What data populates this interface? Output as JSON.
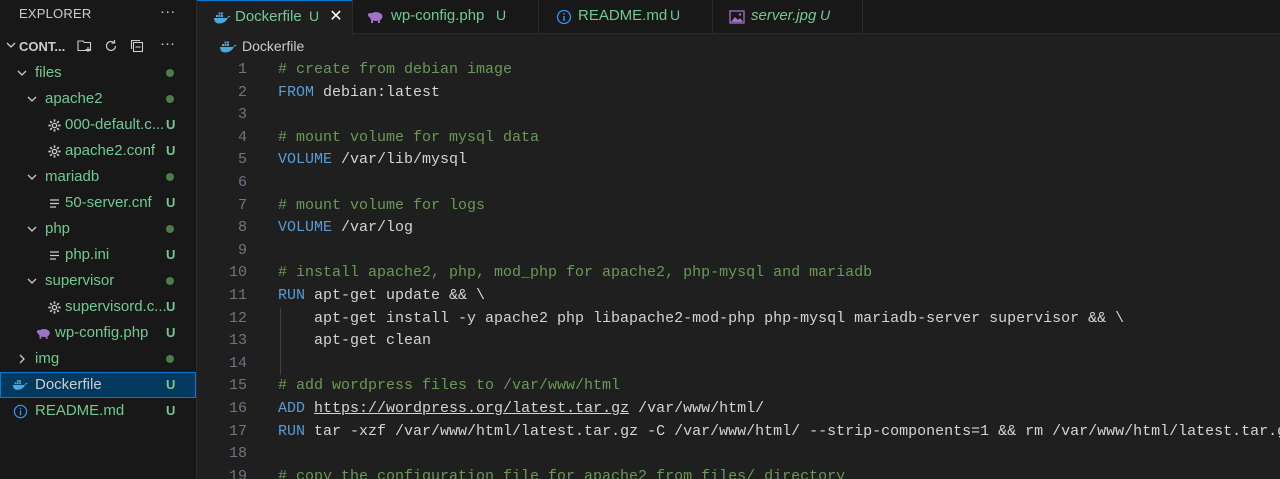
{
  "explorer": {
    "title": "EXPLORER",
    "section_title": "CONT...",
    "tree": [
      {
        "label": "files",
        "kind": "folder",
        "depth": 1,
        "open": true,
        "status": "dot"
      },
      {
        "label": "apache2",
        "kind": "folder",
        "depth": 2,
        "open": true,
        "status": "dot"
      },
      {
        "label": "000-default.c...",
        "kind": "gear",
        "depth": 3,
        "status": "U"
      },
      {
        "label": "apache2.conf",
        "kind": "gear",
        "depth": 3,
        "status": "U"
      },
      {
        "label": "mariadb",
        "kind": "folder",
        "depth": 2,
        "open": true,
        "status": "dot"
      },
      {
        "label": "50-server.cnf",
        "kind": "lines",
        "depth": 3,
        "status": "U"
      },
      {
        "label": "php",
        "kind": "folder",
        "depth": 2,
        "open": true,
        "status": "dot"
      },
      {
        "label": "php.ini",
        "kind": "lines",
        "depth": 3,
        "status": "U"
      },
      {
        "label": "supervisor",
        "kind": "folder",
        "depth": 2,
        "open": true,
        "status": "dot"
      },
      {
        "label": "supervisord.c...",
        "kind": "gear",
        "depth": 3,
        "status": "U"
      },
      {
        "label": "wp-config.php",
        "kind": "php",
        "depth": 2,
        "status": "U"
      },
      {
        "label": "img",
        "kind": "folder",
        "depth": 1,
        "open": false,
        "status": "dot"
      },
      {
        "label": "Dockerfile",
        "kind": "docker",
        "depth": 0,
        "status": "U",
        "selected": true
      },
      {
        "label": "README.md",
        "kind": "info",
        "depth": 0,
        "status": "U"
      }
    ]
  },
  "tabs": [
    {
      "label": "Dockerfile",
      "badge": "U",
      "icon": "docker-icon",
      "active": true,
      "close": "✕"
    },
    {
      "label": "wp-config.php",
      "badge": "U",
      "icon": "php-icon",
      "active": false
    },
    {
      "label": "README.md",
      "badge": "U",
      "icon": "info-icon",
      "active": false
    },
    {
      "label": "server.jpg",
      "badge": "U",
      "icon": "image-icon",
      "active": false,
      "italic": true
    }
  ],
  "breadcrumb": {
    "file": "Dockerfile"
  },
  "editor": {
    "lines": [
      {
        "n": "1",
        "parts": [
          [
            "c",
            "# create from debian image"
          ]
        ]
      },
      {
        "n": "2",
        "parts": [
          [
            "k",
            "FROM"
          ],
          [
            "t",
            " debian:latest"
          ]
        ]
      },
      {
        "n": "3",
        "parts": []
      },
      {
        "n": "4",
        "parts": [
          [
            "c",
            "# mount volume for mysql data"
          ]
        ]
      },
      {
        "n": "5",
        "parts": [
          [
            "k",
            "VOLUME"
          ],
          [
            "t",
            " /var/lib/mysql"
          ]
        ]
      },
      {
        "n": "6",
        "parts": []
      },
      {
        "n": "7",
        "parts": [
          [
            "c",
            "# mount volume for logs"
          ]
        ]
      },
      {
        "n": "8",
        "parts": [
          [
            "k",
            "VOLUME"
          ],
          [
            "t",
            " /var/log"
          ]
        ]
      },
      {
        "n": "9",
        "parts": []
      },
      {
        "n": "10",
        "parts": [
          [
            "c",
            "# install apache2, php, mod_php for apache2, php-mysql and mariadb"
          ]
        ]
      },
      {
        "n": "11",
        "parts": [
          [
            "k",
            "RUN"
          ],
          [
            "t",
            " apt-get update && \\"
          ]
        ]
      },
      {
        "n": "12",
        "parts": [
          [
            "t",
            "    apt-get install -y apache2 php libapache2-mod-php php-mysql mariadb-server supervisor && \\"
          ]
        ]
      },
      {
        "n": "13",
        "parts": [
          [
            "t",
            "    apt-get clean"
          ]
        ]
      },
      {
        "n": "14",
        "parts": []
      },
      {
        "n": "15",
        "parts": [
          [
            "c",
            "# add wordpress files to /var/www/html"
          ]
        ]
      },
      {
        "n": "16",
        "parts": [
          [
            "k",
            "ADD"
          ],
          [
            "t",
            " "
          ],
          [
            "u",
            "https://wordpress.org/latest.tar.gz"
          ],
          [
            "t",
            " /var/www/html/"
          ]
        ]
      },
      {
        "n": "17",
        "parts": [
          [
            "k",
            "RUN"
          ],
          [
            "t",
            " tar -xzf /var/www/html/latest.tar.gz -C /var/www/html/ --strip-components=1 && rm /var/www/html/latest.tar.gz"
          ]
        ]
      },
      {
        "n": "18",
        "parts": []
      },
      {
        "n": "19",
        "parts": [
          [
            "c",
            "# copy the configuration file for apache2 from files/ directory"
          ]
        ]
      }
    ]
  },
  "colors": {
    "accent": "#0078d4",
    "untracked": "#73c991",
    "comment": "#6a9955",
    "keyword": "#569cd6",
    "docker": "#4ea7d8",
    "php": "#a074c4",
    "info": "#3794ff"
  }
}
